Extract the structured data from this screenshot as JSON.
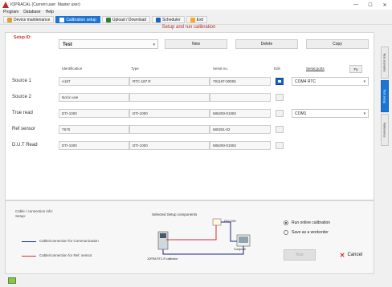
{
  "window": {
    "title": "IOPRACAL (Current user: Master user)",
    "controls": [
      "—",
      "☐",
      "✕"
    ]
  },
  "menu": [
    "Program",
    "Database",
    "Help"
  ],
  "toolbar": [
    {
      "label": "Device maintenance",
      "icon_color": "#e0a030",
      "active": false
    },
    {
      "label": "Calibration setup",
      "icon_color": "#ffffff",
      "active": true
    },
    {
      "label": "Upload / Download",
      "icon_color": "#2e7d32",
      "active": false
    },
    {
      "label": "Scheduler",
      "icon_color": "#1565c0",
      "active": false
    },
    {
      "label": "Exit",
      "icon_color": "#f9a825",
      "active": false
    }
  ],
  "page_title": "Setup and run calibration",
  "setup": {
    "label": "Setup ID:",
    "value": "Test",
    "buttons": {
      "new": "New",
      "delete": "Delete",
      "copy": "Copy"
    }
  },
  "grid": {
    "headers": {
      "identification": "Identification",
      "type": "Type",
      "serial": "Serial no.",
      "edit": "Edit",
      "serial_ports": "Serial ports"
    },
    "refresh_button": "Fy",
    "rows": [
      {
        "label": "Source 1",
        "identification": "A187",
        "type": "RTC-187 R",
        "serial": "791187-00006",
        "edit_hot": true,
        "port": "COM4 RTC"
      },
      {
        "label": "Source 2",
        "identification": "Not in use",
        "type": "",
        "serial": "",
        "edit_hot": false,
        "port": ""
      },
      {
        "label": "True read",
        "identification": "DTI-1000",
        "type": "DTI-1000",
        "serial": "686250-01082",
        "edit_hot": false,
        "port": "COM1"
      },
      {
        "label": "Ref sensor",
        "identification": "T570",
        "type": "",
        "serial": "680251-02",
        "edit_hot": false,
        "port": ""
      },
      {
        "label": "D.U.T Read",
        "identification": "DTI-1000",
        "type": "DTI-1000",
        "serial": "686250-01082",
        "edit_hot": false,
        "port": ""
      }
    ]
  },
  "side_tabs": [
    "Test scenario",
    "Test setup",
    "Reference"
  ],
  "bottom": {
    "legend_title": "Cable / connection info:",
    "legend_sub": "Setup:",
    "legend": [
      {
        "text": "Cable/connection for Communication",
        "color": "#1a237e"
      },
      {
        "text": "Cable/connection for Ref. sensor",
        "color": "#d32f2f"
      }
    ],
    "diagram_title": "Selected Setup components",
    "diagram_labels": {
      "dti": "DTI-1000",
      "rtc": "JOFRA RTC-R calibrator",
      "computer": "Computer"
    },
    "options": [
      {
        "label": "Run online calibration",
        "selected": true
      },
      {
        "label": "Save as a workorder",
        "selected": false
      }
    ],
    "run_label": "Run",
    "cancel_label": "Cancel"
  }
}
